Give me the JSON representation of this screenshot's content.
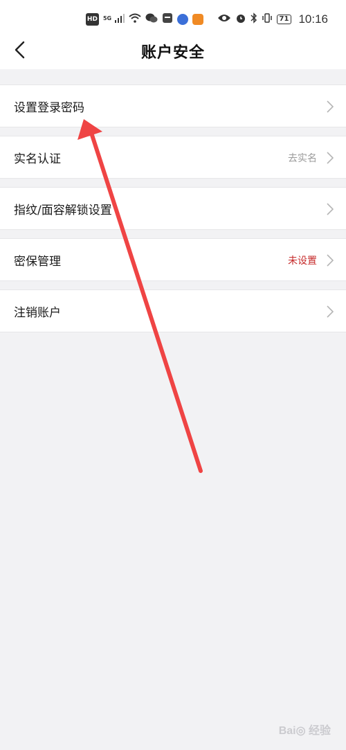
{
  "status_bar": {
    "hd_label": "HD",
    "network_label": "5G",
    "battery": "71",
    "time": "10:16",
    "icons": [
      "signal-icon",
      "wifi-icon",
      "wechat-icon",
      "message-icon",
      "app-blue-icon",
      "app-orange-icon",
      "eye-icon",
      "alarm-icon",
      "bluetooth-icon",
      "vibrate-icon",
      "battery-icon"
    ]
  },
  "header": {
    "title": "账户安全",
    "back_icon": "chevron-left-icon"
  },
  "settings": {
    "items": [
      {
        "label": "设置登录密码",
        "value": ""
      },
      {
        "label": "实名认证",
        "value": "去实名"
      },
      {
        "label": "指纹/面容解锁设置",
        "value": ""
      },
      {
        "label": "密保管理",
        "value": "未设置"
      },
      {
        "label": "注销账户",
        "value": ""
      }
    ]
  },
  "colors": {
    "accent_red": "#c62a2a",
    "annotation_red": "#ef4444",
    "background": "#f2f2f4"
  },
  "watermark": {
    "text": "Bai◎ 经验"
  }
}
